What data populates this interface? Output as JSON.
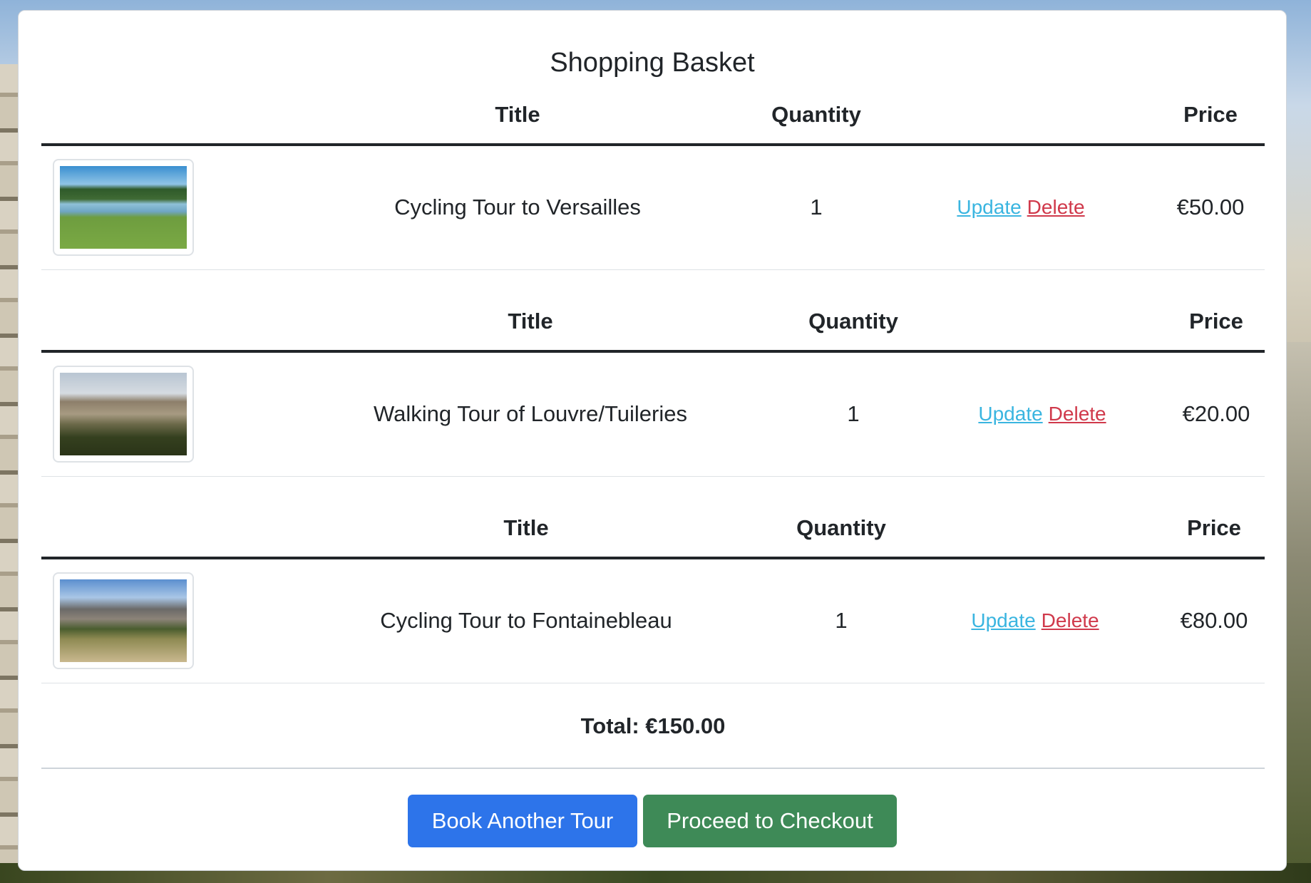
{
  "page": {
    "title": "Shopping Basket"
  },
  "headers": {
    "title": "Title",
    "quantity": "Quantity",
    "price": "Price"
  },
  "items": [
    {
      "title": "Cycling Tour to Versailles",
      "quantity": "1",
      "price": "€50.00",
      "update": "Update",
      "delete": "Delete",
      "image": "versailles-photo"
    },
    {
      "title": "Walking Tour of Louvre/Tuileries",
      "quantity": "1",
      "price": "€20.00",
      "update": "Update",
      "delete": "Delete",
      "image": "louvre-photo"
    },
    {
      "title": "Cycling Tour to Fontainebleau",
      "quantity": "1",
      "price": "€80.00",
      "update": "Update",
      "delete": "Delete",
      "image": "fontainebleau-photo"
    }
  ],
  "total": {
    "label": "Total: €150.00"
  },
  "buttons": {
    "book_another": "Book Another Tour",
    "checkout": "Proceed to Checkout"
  },
  "colors": {
    "primary": "#2d74ea",
    "success": "#3e8a57",
    "update_link": "#3ab5e0",
    "delete_link": "#d0394b"
  }
}
